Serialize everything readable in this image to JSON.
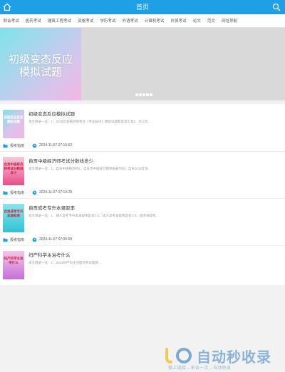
{
  "header": {
    "title": "首页",
    "home_icon": "home-icon",
    "search_icon": "search-icon",
    "bg_color": "#1e9fe6"
  },
  "nav": {
    "items": [
      "财会考试",
      "医药考试",
      "建筑工程考试",
      "资格考试",
      "学历考试",
      "外语考试",
      "计算机考试",
      "外贸考试",
      "论文",
      "范文",
      "网址导航"
    ]
  },
  "banner": {
    "poster_text": "初级变态反应模拟试题",
    "dot_count": 5
  },
  "articles": [
    {
      "thumb_text": "初级变态反应模拟试题",
      "title": "初级变态反应模拟试题",
      "excerpt": "本文目录一览：1、2018年初级药师考试《专业知识》模拟试题及答案汇总2、近三年…",
      "category": "报考指南",
      "date": "2024-11-07 07:15:52"
    },
    {
      "thumb_text": "自贡中级经济师考试分数线多少",
      "title": "自贡中级经济师考试分数线多少",
      "excerpt": "本文目录一览：1、自贡中级经济师2、自贡市中级会计职称报名时间、自贡2019年会…",
      "category": "报考指南",
      "date": "2024-11-07 07:10:20"
    },
    {
      "thumb_text": "自贡成考专升本录取率",
      "title": "自贡成考专升本录取率",
      "excerpt": "本文目录一览：1、成人高考专升本录取率是多少2、成人高考录取率是多少3、成考录取率…",
      "category": "报考指南",
      "date": "2024-11-07 07:05:09"
    },
    {
      "thumb_text": "妇产科学主治考什么",
      "title": "妇产科学主治考什么",
      "excerpt": "本文目录一览：1、2024妇产科主治医师考试题目…",
      "category": "",
      "date": ""
    }
  ],
  "watermark": {
    "big_text": "自动秒收录",
    "small_text": "做上链接→来访一次→自动收录"
  }
}
